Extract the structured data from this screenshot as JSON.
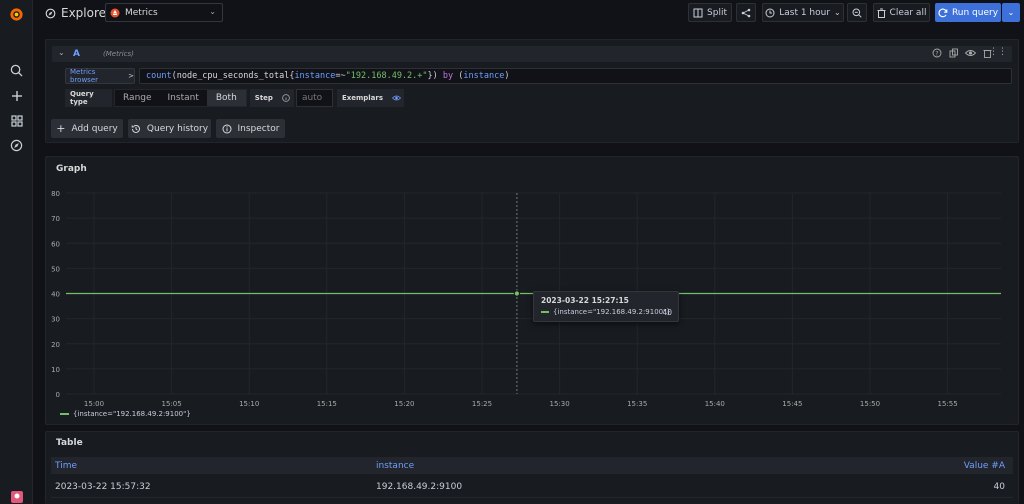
{
  "app": {
    "title": "Explore"
  },
  "datasource": {
    "selected": "Metrics"
  },
  "toolbar": {
    "split": "Split",
    "time_range": "Last 1 hour",
    "clear_all": "Clear all",
    "run_query": "Run query"
  },
  "query": {
    "ref_id": "A",
    "datasource_hint": "(Metrics)",
    "metrics_browser": "Metrics browser",
    "metrics_browser_chevron": ">",
    "expr_parts": {
      "fn": "count",
      "open": "(",
      "metric": "node_cpu_seconds_total",
      "brace_open": "{",
      "label": "instance",
      "op": "=~",
      "value": "\"192.168.49.2.+\"",
      "brace_close": "}",
      "close": ")",
      "by": "by",
      "group_open": "(",
      "group_label": "instance",
      "group_close": ")"
    },
    "query_type_label": "Query type",
    "types": [
      "Range",
      "Instant",
      "Both"
    ],
    "selected_type": "Both",
    "step_label": "Step",
    "step_placeholder": "auto",
    "exemplars_label": "Exemplars"
  },
  "actions": {
    "add_query": "Add query",
    "query_history": "Query history",
    "inspector": "Inspector"
  },
  "graph": {
    "title": "Graph"
  },
  "chart_data": {
    "type": "line",
    "y_ticks": [
      0,
      10,
      20,
      30,
      40,
      50,
      60,
      70,
      80
    ],
    "ylim": [
      0,
      80
    ],
    "x_ticks": [
      "15:00",
      "15:05",
      "15:10",
      "15:15",
      "15:20",
      "15:25",
      "15:30",
      "15:35",
      "15:40",
      "15:45",
      "15:50",
      "15:55"
    ],
    "series": [
      {
        "name": "{instance=\"192.168.49.2:9100\"}",
        "value": 40,
        "color": "#73bf69"
      }
    ],
    "legend": "bottom-left",
    "tooltip": {
      "time": "2023-03-22 15:27:15",
      "series": "{instance=\"192.168.49.2:9100\"}",
      "value": "40",
      "x_at": "15:27:15"
    }
  },
  "table": {
    "title": "Table",
    "columns": [
      "Time",
      "instance",
      "Value #A"
    ],
    "rows": [
      [
        "2023-03-22 15:57:32",
        "192.168.49.2:9100",
        "40"
      ]
    ]
  },
  "colors": {
    "accent": "#3d71d9",
    "series": "#73bf69",
    "bg": "#111217",
    "panel": "#181b1f"
  }
}
